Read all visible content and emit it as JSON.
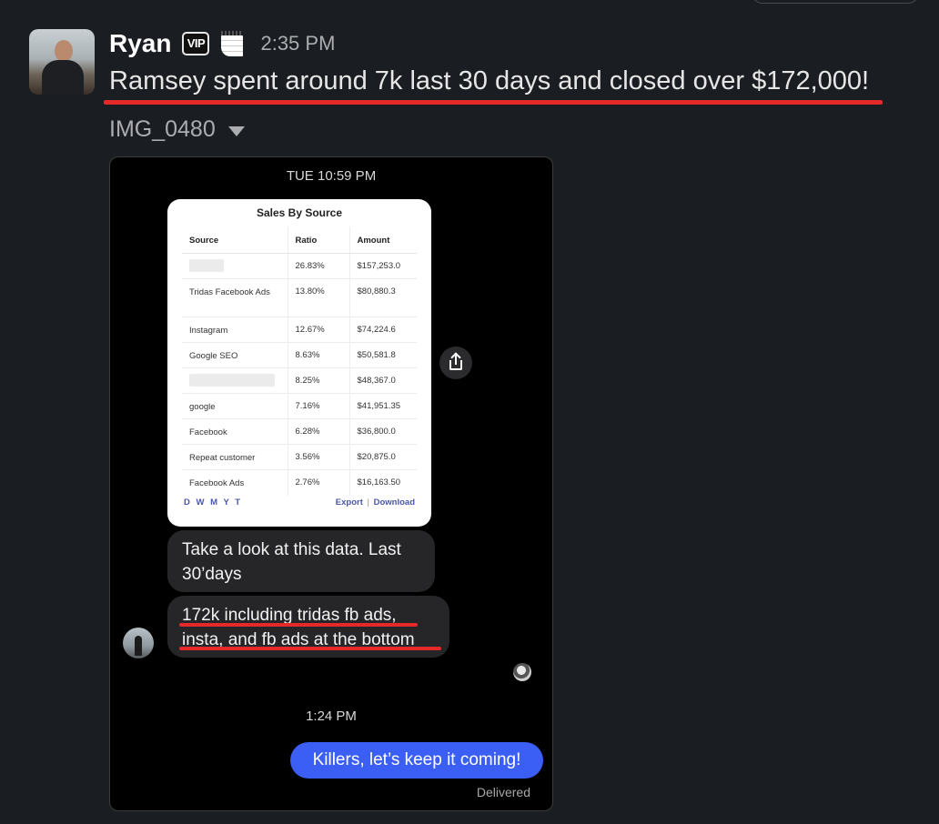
{
  "message": {
    "sender": "Ryan",
    "badge": "VIP",
    "status_emoji_icon": "calendar-icon",
    "timestamp": "2:35 PM",
    "text": "Ramsey spent around 7k last 30 days and closed over $172,000!",
    "attachment_name": "IMG_0480"
  },
  "screenshot": {
    "top_time": "TUE 10:59 PM",
    "card": {
      "title": "Sales By Source",
      "columns": [
        "Source",
        "Ratio",
        "Amount"
      ],
      "rows": [
        {
          "source": "",
          "ratio": "26.83%",
          "amount": "$157,253.0"
        },
        {
          "source": "Tridas Facebook Ads",
          "ratio": "13.80%",
          "amount": "$80,880.3"
        },
        {
          "source": "Instagram",
          "ratio": "12.67%",
          "amount": "$74,224.6"
        },
        {
          "source": "Google SEO",
          "ratio": "8.63%",
          "amount": "$50,581.8"
        },
        {
          "source": "",
          "ratio": "8.25%",
          "amount": "$48,367.0"
        },
        {
          "source": "google",
          "ratio": "7.16%",
          "amount": "$41,951.35"
        },
        {
          "source": "Facebook",
          "ratio": "6.28%",
          "amount": "$36,800.0"
        },
        {
          "source": "Repeat customer",
          "ratio": "3.56%",
          "amount": "$20,875.0"
        },
        {
          "source": "Facebook Ads",
          "ratio": "2.76%",
          "amount": "$16,163.50"
        }
      ],
      "periods": "D W M Y T",
      "export_label": "Export",
      "separator": "|",
      "download_label": "Download"
    },
    "bubble1": "Take a look at this data. Last 30’days",
    "bubble2": "172k including tridas fb ads, insta, and fb ads at the bottom",
    "mid_time": "1:24 PM",
    "sent_message": "Killers, let’s keep it coming!",
    "delivered": "Delivered"
  },
  "colors": {
    "background": "#1a1d21",
    "underline": "#e32929",
    "sent_bubble": "#3b5ef5",
    "received_bubble": "#262628"
  }
}
